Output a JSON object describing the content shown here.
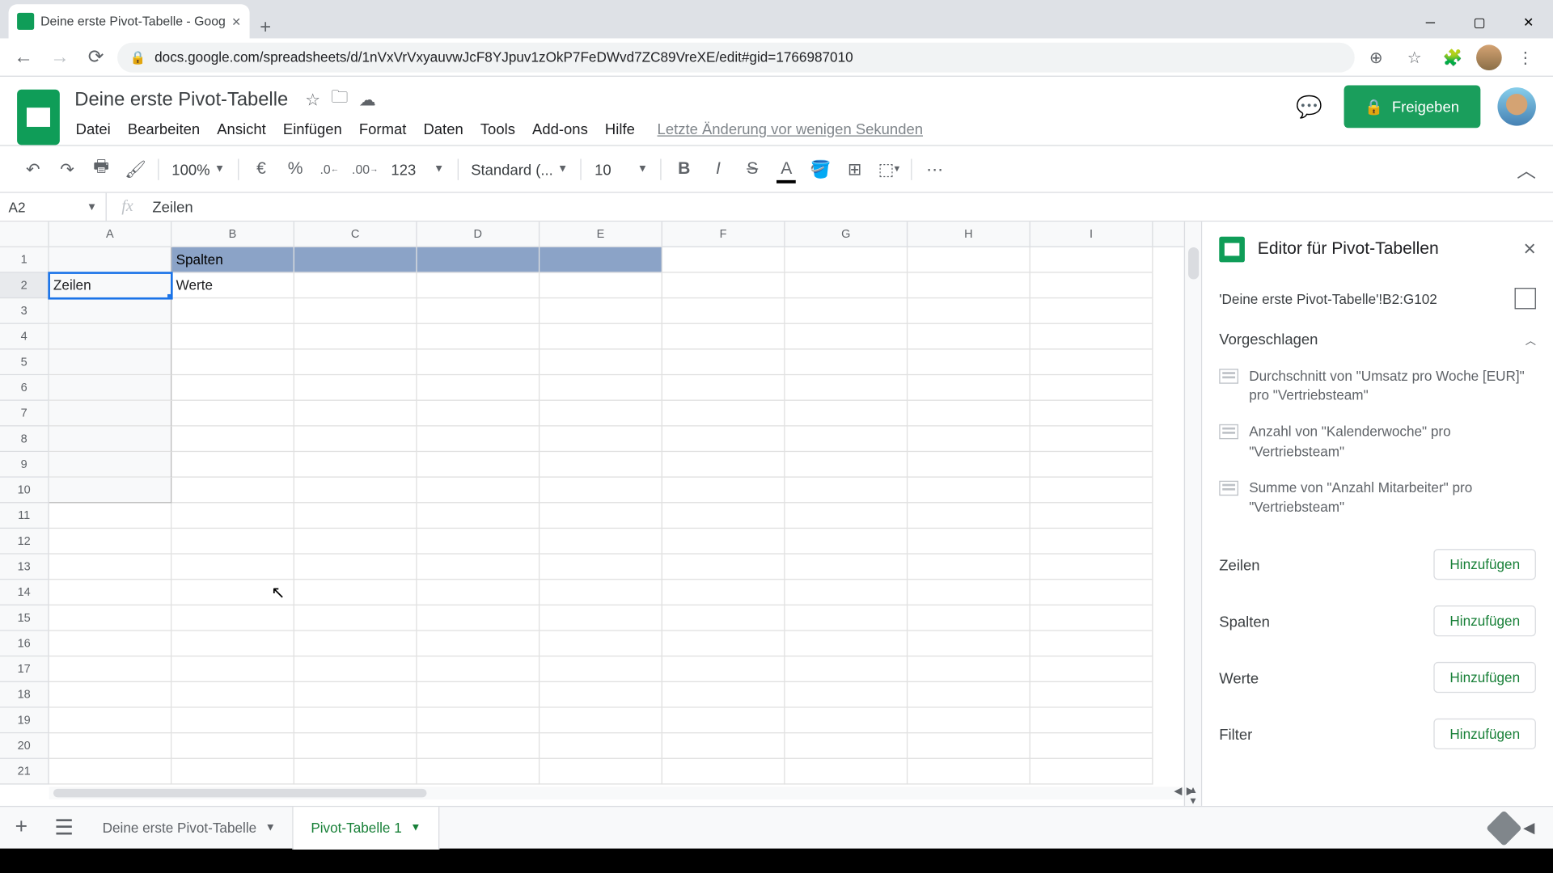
{
  "browser": {
    "tab_title": "Deine erste Pivot-Tabelle - Goog",
    "url": "docs.google.com/spreadsheets/d/1nVxVrVxyauvwJcF8YJpuv1zOkP7FeDWvd7ZC89VreXE/edit#gid=1766987010"
  },
  "doc": {
    "title": "Deine erste Pivot-Tabelle",
    "last_edit": "Letzte Änderung vor wenigen Sekunden"
  },
  "menu": [
    "Datei",
    "Bearbeiten",
    "Ansicht",
    "Einfügen",
    "Format",
    "Daten",
    "Tools",
    "Add-ons",
    "Hilfe"
  ],
  "share_label": "Freigeben",
  "toolbar": {
    "zoom": "100%",
    "currency": "€",
    "pct": "%",
    "dec_dec": ".0",
    "inc_dec": ".00",
    "numfmt": "123",
    "font": "Standard (...",
    "size": "10"
  },
  "name_box": "A2",
  "formula": "Zeilen",
  "columns": [
    "A",
    "B",
    "C",
    "D",
    "E",
    "F",
    "G",
    "H",
    "I"
  ],
  "rows": [
    1,
    2,
    3,
    4,
    5,
    6,
    7,
    8,
    9,
    10,
    11,
    12,
    13,
    14,
    15,
    16,
    17,
    18,
    19,
    20,
    21
  ],
  "cells": {
    "B1": "Spalten",
    "A2": "Zeilen",
    "B2": "Werte"
  },
  "pivot": {
    "title": "Editor für Pivot-Tabellen",
    "range": "'Deine erste Pivot-Tabelle'!B2:G102",
    "suggested_header": "Vorgeschlagen",
    "suggestions": [
      "Durchschnitt von \"Umsatz pro Woche [EUR]\" pro \"Vertriebsteam\"",
      "Anzahl von \"Kalenderwoche\" pro \"Vertriebsteam\"",
      "Summe von \"Anzahl Mitarbeiter\" pro \"Vertriebsteam\""
    ],
    "fields": {
      "rows": "Zeilen",
      "cols": "Spalten",
      "vals": "Werte",
      "filt": "Filter"
    },
    "add": "Hinzufügen"
  },
  "sheets": {
    "tab1": "Deine erste Pivot-Tabelle",
    "tab2": "Pivot-Tabelle 1"
  }
}
